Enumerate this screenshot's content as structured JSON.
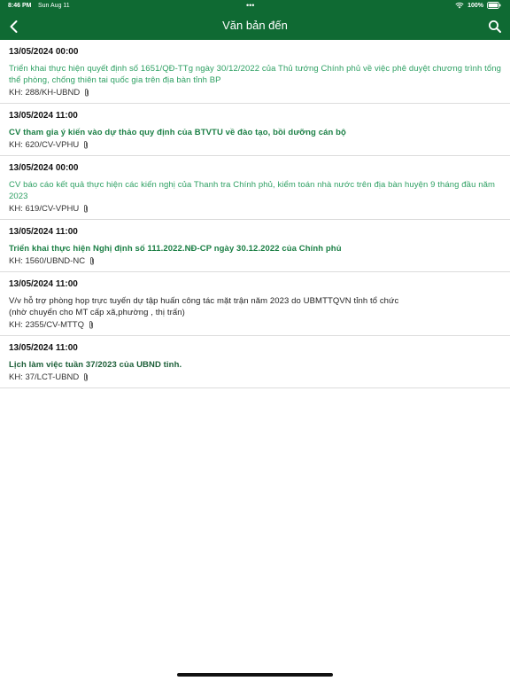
{
  "status_bar": {
    "time": "8:46 PM",
    "date": "Sun Aug 11",
    "dots": "•••",
    "battery": "100%"
  },
  "header": {
    "title": "Văn bản đến",
    "back_icon": "chevron-left-icon",
    "search_icon": "search-icon",
    "background_color": "#0f6a33"
  },
  "documents": [
    {
      "date": "13/05/2024 00:00",
      "title": "Triển khai thực hiện quyết định số 1651/QĐ-TTg ngày 30/12/2022 của Thủ tướng Chính phủ về việc phê duyệt chương trình tổng thể phòng, chống thiên tai quốc gia trên địa bàn tỉnh BP",
      "code": "KH: 288/KH-UBND"
    },
    {
      "date": "13/05/2024 11:00",
      "title": "CV tham gia ý kiến vào dự thảo quy định của BTVTU về đào tạo, bồi dưỡng cán bộ",
      "code": "KH: 620/CV-VPHU"
    },
    {
      "date": "13/05/2024 00:00",
      "title": "CV báo cáo kết quả thực hiện các kiến nghị của Thanh tra Chính phủ, kiểm toán nhà nước trên địa bàn huyện 9 tháng đầu năm 2023",
      "code": "KH: 619/CV-VPHU"
    },
    {
      "date": "13/05/2024 11:00",
      "title": "Triển khai thực hiện Nghị định số 111.2022.NĐ-CP ngày 30.12.2022 của Chính phủ",
      "code": "KH: 1560/UBND-NC"
    },
    {
      "date": "13/05/2024 11:00",
      "title": "V/v hỗ trợ phòng họp trực tuyến dự tập huấn công tác mặt trận năm 2023 do UBMTTQVN tỉnh tổ chức\n(nhờ chuyển cho MT cấp xã,phường , thị trấn)",
      "code": "KH: 2355/CV-MTTQ"
    },
    {
      "date": "13/05/2024 11:00",
      "title": "Lịch làm việc tuần 37/2023 của UBND tỉnh.",
      "code": "KH: 37/LCT-UBND"
    }
  ],
  "colors": {
    "accent": "#0f6a33",
    "title_green": "#2ea063",
    "title_green_bold": "#1b7f45"
  }
}
